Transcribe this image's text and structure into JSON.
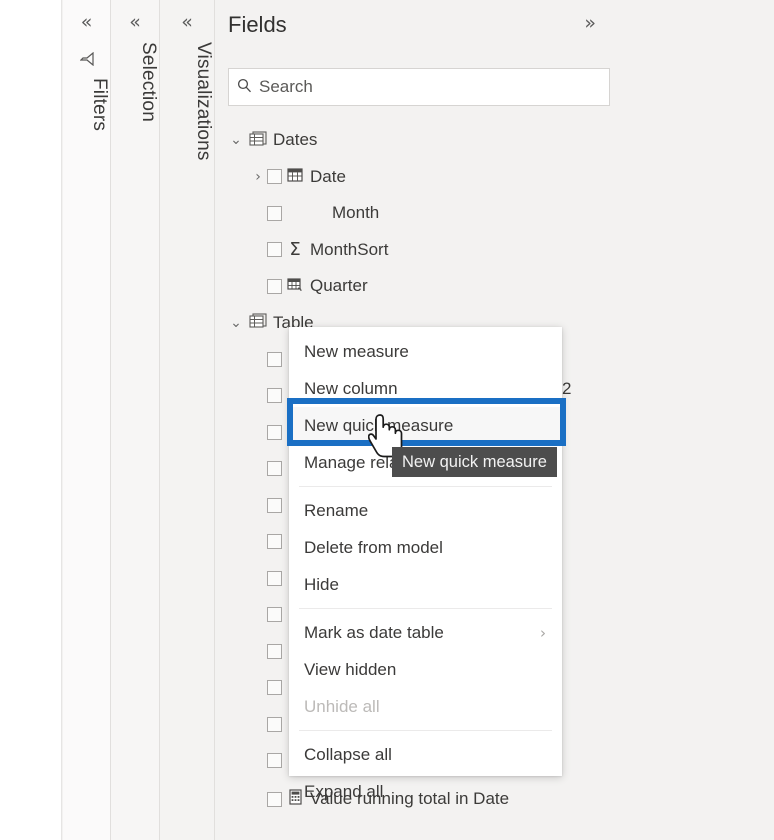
{
  "panes": {
    "filters": {
      "label": "Filters",
      "collapse_icon": "«",
      "pane_icon": "filter-funnel"
    },
    "selection": {
      "label": "Selection",
      "collapse_icon": "«"
    },
    "visualizations": {
      "label": "Visualizations",
      "collapse_icon": "«"
    }
  },
  "fields": {
    "title": "Fields",
    "expand_icon": "»",
    "search": {
      "placeholder": "Search",
      "value": "",
      "icon": "search-icon"
    },
    "tree": [
      {
        "label": "Dates",
        "level": 0,
        "twisty": "expanded",
        "icon": "table-icon",
        "checkbox": false
      },
      {
        "label": "Date",
        "level": 1,
        "twisty": "collapsed",
        "icon": "calendar-icon",
        "checkbox": true
      },
      {
        "label": "Month",
        "level": 2,
        "twisty": "none",
        "icon": "none",
        "checkbox": true
      },
      {
        "label": "MonthSort",
        "level": 2,
        "twisty": "none",
        "icon": "sigma-icon",
        "checkbox": true
      },
      {
        "label": "Quarter",
        "level": 2,
        "twisty": "none",
        "icon": "hierarchy-icon",
        "checkbox": true
      },
      {
        "label": "Table",
        "level": 0,
        "twisty": "expanded",
        "icon": "table-icon",
        "checkbox": false
      }
    ],
    "hidden_rows_count": 12,
    "occluded_text": "2",
    "last_row": {
      "label": "Value running total in Date",
      "icon": "calculator-icon",
      "checkbox": true
    }
  },
  "context_menu": {
    "items": [
      {
        "label": "New measure",
        "disabled": false,
        "submenu": false,
        "separator_after": false,
        "selected": false
      },
      {
        "label": "New column",
        "disabled": false,
        "submenu": false,
        "separator_after": false,
        "selected": false
      },
      {
        "label": "New quick measure",
        "disabled": false,
        "submenu": false,
        "separator_after": false,
        "selected": true
      },
      {
        "label": "Manage relationships",
        "disabled": false,
        "submenu": false,
        "separator_after": true,
        "selected": false
      },
      {
        "label": "Rename",
        "disabled": false,
        "submenu": false,
        "separator_after": false,
        "selected": false
      },
      {
        "label": "Delete from model",
        "disabled": false,
        "submenu": false,
        "separator_after": false,
        "selected": false
      },
      {
        "label": "Hide",
        "disabled": false,
        "submenu": false,
        "separator_after": true,
        "selected": false
      },
      {
        "label": "Mark as date table",
        "disabled": false,
        "submenu": true,
        "separator_after": false,
        "selected": false
      },
      {
        "label": "View hidden",
        "disabled": false,
        "submenu": false,
        "separator_after": false,
        "selected": false
      },
      {
        "label": "Unhide all",
        "disabled": true,
        "submenu": false,
        "separator_after": true,
        "selected": false
      },
      {
        "label": "Collapse all",
        "disabled": false,
        "submenu": false,
        "separator_after": false,
        "selected": false
      },
      {
        "label": "Expand all",
        "disabled": false,
        "submenu": false,
        "separator_after": false,
        "selected": false
      }
    ],
    "submenu_arrow": "›"
  },
  "tooltip": {
    "text": "New quick measure"
  },
  "highlight": {
    "color": "#1a6fc4",
    "target": "New quick measure"
  },
  "cursor": {
    "type": "pointing-hand"
  }
}
